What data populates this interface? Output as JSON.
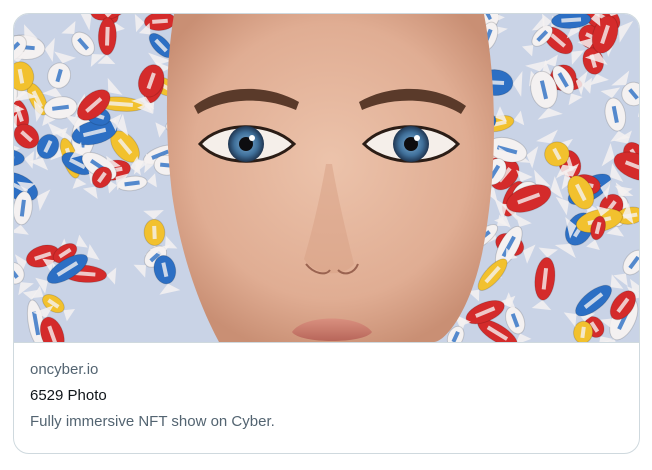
{
  "link_card": {
    "domain": "oncyber.io",
    "title": "6529 Photo",
    "description": "Fully immersive NFT show on Cyber.",
    "image_subject": "woman-face-surrounded-by-wrapped-candies"
  },
  "colors": {
    "border": "#cfd9de",
    "muted_text": "#536471",
    "primary_text": "#0f1419",
    "skin": "#e3b49b",
    "lips": "#c98273",
    "iris": "#4d7fa8",
    "candy_red": "#d42b2b",
    "candy_yellow": "#f2c12e",
    "candy_blue": "#2c6fc4",
    "candy_white": "#f4f1f1"
  }
}
